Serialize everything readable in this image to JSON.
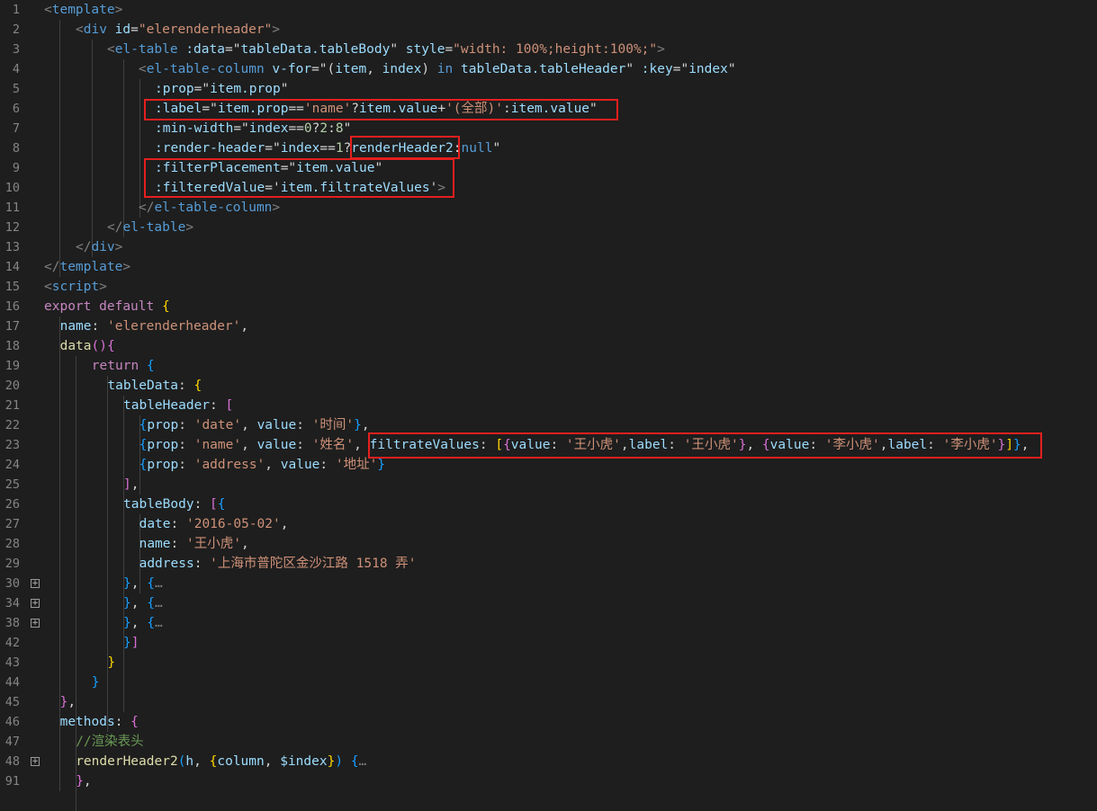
{
  "editor": {
    "language": "vue",
    "lines": [
      {
        "n": "1",
        "indent": 0,
        "fold": false,
        "tokens": [
          [
            "t-br",
            "<"
          ],
          [
            "t-tag",
            "template"
          ],
          [
            "t-br",
            ">"
          ]
        ]
      },
      {
        "n": "2",
        "indent": 1,
        "fold": false,
        "tokens": [
          [
            "t-br",
            "<"
          ],
          [
            "t-tag",
            "div"
          ],
          [
            "t-pl",
            " "
          ],
          [
            "t-attr",
            "id"
          ],
          [
            "t-pl",
            "="
          ],
          [
            "t-str",
            "\"elerenderheader\""
          ],
          [
            "t-br",
            ">"
          ]
        ]
      },
      {
        "n": "3",
        "indent": 2,
        "fold": false,
        "tokens": [
          [
            "t-br",
            "<"
          ],
          [
            "t-tag",
            "el-table"
          ],
          [
            "t-pl",
            " "
          ],
          [
            "t-attr",
            ":data"
          ],
          [
            "t-pl",
            "=\""
          ],
          [
            "t-attr",
            "tableData.tableBody"
          ],
          [
            "t-pl",
            "\" "
          ],
          [
            "t-attr",
            "style"
          ],
          [
            "t-pl",
            "="
          ],
          [
            "t-str",
            "\"width: 100%;height:100%;\""
          ],
          [
            "t-br",
            ">"
          ]
        ]
      },
      {
        "n": "4",
        "indent": 3,
        "fold": false,
        "tokens": [
          [
            "t-br",
            "<"
          ],
          [
            "t-tag",
            "el-table-column"
          ],
          [
            "t-pl",
            " "
          ],
          [
            "t-attr",
            "v-for"
          ],
          [
            "t-pl",
            "=\"("
          ],
          [
            "t-attr",
            "item"
          ],
          [
            "t-pl",
            ", "
          ],
          [
            "t-attr",
            "index"
          ],
          [
            "t-pl",
            ") "
          ],
          [
            "t-kw",
            "in"
          ],
          [
            "t-pl",
            " "
          ],
          [
            "t-attr",
            "tableData.tableHeader"
          ],
          [
            "t-pl",
            "\" "
          ],
          [
            "t-attr",
            ":key"
          ],
          [
            "t-pl",
            "=\""
          ],
          [
            "t-attr",
            "index"
          ],
          [
            "t-pl",
            "\""
          ]
        ]
      },
      {
        "n": "5",
        "indent": 3,
        "fold": false,
        "extra": 1,
        "tokens": [
          [
            "t-attr",
            ":prop"
          ],
          [
            "t-pl",
            "=\""
          ],
          [
            "t-attr",
            "item.prop"
          ],
          [
            "t-pl",
            "\""
          ]
        ]
      },
      {
        "n": "6",
        "indent": 3,
        "fold": false,
        "extra": 1,
        "tokens": [
          [
            "t-attr",
            ":label"
          ],
          [
            "t-pl",
            "=\""
          ],
          [
            "t-attr",
            "item.prop"
          ],
          [
            "t-pl",
            "=="
          ],
          [
            "t-str",
            "'name'"
          ],
          [
            "t-pl",
            "?"
          ],
          [
            "t-attr",
            "item.value"
          ],
          [
            "t-pl",
            "+"
          ],
          [
            "t-str",
            "'(全部)'"
          ],
          [
            "t-pl",
            ":"
          ],
          [
            "t-attr",
            "item.value"
          ],
          [
            "t-pl",
            "\""
          ]
        ]
      },
      {
        "n": "7",
        "indent": 3,
        "fold": false,
        "extra": 1,
        "tokens": [
          [
            "t-attr",
            ":min-width"
          ],
          [
            "t-pl",
            "=\""
          ],
          [
            "t-attr",
            "index"
          ],
          [
            "t-pl",
            "=="
          ],
          [
            "t-num",
            "0"
          ],
          [
            "t-pl",
            "?"
          ],
          [
            "t-num",
            "2"
          ],
          [
            "t-pl",
            ":"
          ],
          [
            "t-num",
            "8"
          ],
          [
            "t-pl",
            "\""
          ]
        ]
      },
      {
        "n": "8",
        "indent": 3,
        "fold": false,
        "extra": 1,
        "tokens": [
          [
            "t-attr",
            ":render-header"
          ],
          [
            "t-pl",
            "=\""
          ],
          [
            "t-attr",
            "index"
          ],
          [
            "t-pl",
            "=="
          ],
          [
            "t-num",
            "1"
          ],
          [
            "t-pl",
            "?"
          ],
          [
            "t-attr",
            "renderHeader2"
          ],
          [
            "t-pl",
            ":"
          ],
          [
            "t-kw",
            "null"
          ],
          [
            "t-pl",
            "\""
          ]
        ]
      },
      {
        "n": "9",
        "indent": 3,
        "fold": false,
        "extra": 1,
        "tokens": [
          [
            "t-attr",
            ":filterPlacement"
          ],
          [
            "t-pl",
            "=\""
          ],
          [
            "t-attr",
            "item.value"
          ],
          [
            "t-pl",
            "\""
          ]
        ]
      },
      {
        "n": "10",
        "indent": 3,
        "fold": false,
        "extra": 1,
        "tokens": [
          [
            "t-attr",
            ":filteredValue"
          ],
          [
            "t-pl",
            "='"
          ],
          [
            "t-attr",
            "item.filtrateValues"
          ],
          [
            "t-pl",
            "'"
          ],
          [
            "t-br",
            ">"
          ]
        ]
      },
      {
        "n": "11",
        "indent": 3,
        "fold": false,
        "tokens": [
          [
            "t-br",
            "</"
          ],
          [
            "t-tag",
            "el-table-column"
          ],
          [
            "t-br",
            ">"
          ]
        ]
      },
      {
        "n": "12",
        "indent": 2,
        "fold": false,
        "tokens": [
          [
            "t-br",
            "</"
          ],
          [
            "t-tag",
            "el-table"
          ],
          [
            "t-br",
            ">"
          ]
        ]
      },
      {
        "n": "13",
        "indent": 1,
        "fold": false,
        "tokens": [
          [
            "t-br",
            "</"
          ],
          [
            "t-tag",
            "div"
          ],
          [
            "t-br",
            ">"
          ]
        ]
      },
      {
        "n": "14",
        "indent": 0,
        "fold": false,
        "tokens": [
          [
            "t-br",
            "</"
          ],
          [
            "t-tag",
            "template"
          ],
          [
            "t-br",
            ">"
          ]
        ]
      },
      {
        "n": "15",
        "indent": 0,
        "fold": false,
        "tokens": [
          [
            "t-br",
            "<"
          ],
          [
            "t-tag",
            "script"
          ],
          [
            "t-br",
            ">"
          ]
        ]
      },
      {
        "n": "16",
        "indent": 0,
        "fold": false,
        "tokens": [
          [
            "t-ctrl",
            "export"
          ],
          [
            "t-pl",
            " "
          ],
          [
            "t-ctrl",
            "default"
          ],
          [
            "t-pl",
            " "
          ],
          [
            "t-br1",
            "{"
          ]
        ]
      },
      {
        "n": "17",
        "indent": 0,
        "fold": false,
        "sp": 1,
        "tokens": [
          [
            "t-attr",
            "name"
          ],
          [
            "t-pl",
            ": "
          ],
          [
            "t-str",
            "'elerenderheader'"
          ],
          [
            "t-pl",
            ","
          ]
        ]
      },
      {
        "n": "18",
        "indent": 0,
        "fold": false,
        "sp": 1,
        "tokens": [
          [
            "t-fn",
            "data"
          ],
          [
            "t-br2",
            "()"
          ],
          [
            "t-br2",
            "{"
          ]
        ]
      },
      {
        "n": "19",
        "indent": 0,
        "fold": false,
        "sp": 3,
        "tokens": [
          [
            "t-ctrl",
            "return"
          ],
          [
            "t-pl",
            " "
          ],
          [
            "t-br3",
            "{"
          ]
        ]
      },
      {
        "n": "20",
        "indent": 0,
        "fold": false,
        "sp": 4,
        "tokens": [
          [
            "t-attr",
            "tableData"
          ],
          [
            "t-pl",
            ": "
          ],
          [
            "t-br1",
            "{"
          ]
        ]
      },
      {
        "n": "21",
        "indent": 0,
        "fold": false,
        "sp": 5,
        "tokens": [
          [
            "t-attr",
            "tableHeader"
          ],
          [
            "t-pl",
            ": "
          ],
          [
            "t-br2",
            "["
          ]
        ]
      },
      {
        "n": "22",
        "indent": 0,
        "fold": false,
        "sp": 6,
        "tokens": [
          [
            "t-br3",
            "{"
          ],
          [
            "t-attr",
            "prop"
          ],
          [
            "t-pl",
            ": "
          ],
          [
            "t-str",
            "'date'"
          ],
          [
            "t-pl",
            ", "
          ],
          [
            "t-attr",
            "value"
          ],
          [
            "t-pl",
            ": "
          ],
          [
            "t-str",
            "'时间'"
          ],
          [
            "t-br3",
            "}"
          ],
          [
            "t-pl",
            ","
          ]
        ]
      },
      {
        "n": "23",
        "indent": 0,
        "fold": false,
        "sp": 6,
        "tokens": [
          [
            "t-br3",
            "{"
          ],
          [
            "t-attr",
            "prop"
          ],
          [
            "t-pl",
            ": "
          ],
          [
            "t-str",
            "'name'"
          ],
          [
            "t-pl",
            ", "
          ],
          [
            "t-attr",
            "value"
          ],
          [
            "t-pl",
            ": "
          ],
          [
            "t-str",
            "'姓名'"
          ],
          [
            "t-pl",
            ", "
          ],
          [
            "t-attr",
            "filtrateValues"
          ],
          [
            "t-pl",
            ": "
          ],
          [
            "t-br1",
            "["
          ],
          [
            "t-br2",
            "{"
          ],
          [
            "t-attr",
            "value"
          ],
          [
            "t-pl",
            ": "
          ],
          [
            "t-str",
            "'王小虎'"
          ],
          [
            "t-pl",
            ","
          ],
          [
            "t-attr",
            "label"
          ],
          [
            "t-pl",
            ": "
          ],
          [
            "t-str",
            "'王小虎'"
          ],
          [
            "t-br2",
            "}"
          ],
          [
            "t-pl",
            ", "
          ],
          [
            "t-br2",
            "{"
          ],
          [
            "t-attr",
            "value"
          ],
          [
            "t-pl",
            ": "
          ],
          [
            "t-str",
            "'李小虎'"
          ],
          [
            "t-pl",
            ","
          ],
          [
            "t-attr",
            "label"
          ],
          [
            "t-pl",
            ": "
          ],
          [
            "t-str",
            "'李小虎'"
          ],
          [
            "t-br2",
            "}"
          ],
          [
            "t-br1",
            "]"
          ],
          [
            "t-br3",
            "}"
          ],
          [
            "t-pl",
            ","
          ]
        ]
      },
      {
        "n": "24",
        "indent": 0,
        "fold": false,
        "sp": 6,
        "tokens": [
          [
            "t-br3",
            "{"
          ],
          [
            "t-attr",
            "prop"
          ],
          [
            "t-pl",
            ": "
          ],
          [
            "t-str",
            "'address'"
          ],
          [
            "t-pl",
            ", "
          ],
          [
            "t-attr",
            "value"
          ],
          [
            "t-pl",
            ": "
          ],
          [
            "t-str",
            "'地址'"
          ],
          [
            "t-br3",
            "}"
          ]
        ]
      },
      {
        "n": "25",
        "indent": 0,
        "fold": false,
        "sp": 5,
        "tokens": [
          [
            "t-br2",
            "]"
          ],
          [
            "t-pl",
            ","
          ]
        ]
      },
      {
        "n": "26",
        "indent": 0,
        "fold": false,
        "sp": 5,
        "tokens": [
          [
            "t-attr",
            "tableBody"
          ],
          [
            "t-pl",
            ": "
          ],
          [
            "t-br2",
            "["
          ],
          [
            "t-br3",
            "{"
          ]
        ]
      },
      {
        "n": "27",
        "indent": 0,
        "fold": false,
        "sp": 6,
        "tokens": [
          [
            "t-attr",
            "date"
          ],
          [
            "t-pl",
            ": "
          ],
          [
            "t-str",
            "'2016-05-02'"
          ],
          [
            "t-pl",
            ","
          ]
        ]
      },
      {
        "n": "28",
        "indent": 0,
        "fold": false,
        "sp": 6,
        "tokens": [
          [
            "t-attr",
            "name"
          ],
          [
            "t-pl",
            ": "
          ],
          [
            "t-str",
            "'王小虎'"
          ],
          [
            "t-pl",
            ","
          ]
        ]
      },
      {
        "n": "29",
        "indent": 0,
        "fold": false,
        "sp": 6,
        "tokens": [
          [
            "t-attr",
            "address"
          ],
          [
            "t-pl",
            ": "
          ],
          [
            "t-str",
            "'上海市普陀区金沙江路 1518 弄'"
          ]
        ]
      },
      {
        "n": "30",
        "indent": 0,
        "fold": true,
        "sp": 5,
        "tokens": [
          [
            "t-br3",
            "}"
          ],
          [
            "t-pl",
            ", "
          ],
          [
            "t-br3",
            "{"
          ],
          [
            "t-dim",
            "…"
          ]
        ]
      },
      {
        "n": "34",
        "indent": 0,
        "fold": true,
        "sp": 5,
        "tokens": [
          [
            "t-br3",
            "}"
          ],
          [
            "t-pl",
            ", "
          ],
          [
            "t-br3",
            "{"
          ],
          [
            "t-dim",
            "…"
          ]
        ]
      },
      {
        "n": "38",
        "indent": 0,
        "fold": true,
        "sp": 5,
        "tokens": [
          [
            "t-br3",
            "}"
          ],
          [
            "t-pl",
            ", "
          ],
          [
            "t-br3",
            "{"
          ],
          [
            "t-dim",
            "…"
          ]
        ]
      },
      {
        "n": "42",
        "indent": 0,
        "fold": false,
        "sp": 5,
        "tokens": [
          [
            "t-br3",
            "}"
          ],
          [
            "t-br2",
            "]"
          ]
        ]
      },
      {
        "n": "43",
        "indent": 0,
        "fold": false,
        "sp": 4,
        "tokens": [
          [
            "t-br1",
            "}"
          ]
        ]
      },
      {
        "n": "44",
        "indent": 0,
        "fold": false,
        "sp": 3,
        "tokens": [
          [
            "t-br3",
            "}"
          ]
        ]
      },
      {
        "n": "45",
        "indent": 0,
        "fold": false,
        "sp": 1,
        "tokens": [
          [
            "t-br2",
            "}"
          ],
          [
            "t-pl",
            ","
          ]
        ]
      },
      {
        "n": "46",
        "indent": 0,
        "fold": false,
        "sp": 1,
        "tokens": [
          [
            "t-attr",
            "methods"
          ],
          [
            "t-pl",
            ": "
          ],
          [
            "t-br2",
            "{"
          ]
        ]
      },
      {
        "n": "47",
        "indent": 0,
        "fold": false,
        "sp": 2,
        "tokens": [
          [
            "t-com",
            "//渲染表头"
          ]
        ]
      },
      {
        "n": "48",
        "indent": 0,
        "fold": true,
        "sp": 2,
        "tokens": [
          [
            "t-fn",
            "renderHeader2"
          ],
          [
            "t-br3",
            "("
          ],
          [
            "t-attr",
            "h"
          ],
          [
            "t-pl",
            ", "
          ],
          [
            "t-br1",
            "{"
          ],
          [
            "t-attr",
            "column"
          ],
          [
            "t-pl",
            ", "
          ],
          [
            "t-attr",
            "$index"
          ],
          [
            "t-br1",
            "}"
          ],
          [
            "t-br3",
            ")"
          ],
          [
            "t-pl",
            " "
          ],
          [
            "t-br3",
            "{"
          ],
          [
            "t-dim",
            "…"
          ]
        ]
      },
      {
        "n": "91",
        "indent": 0,
        "fold": false,
        "sp": 2,
        "tokens": [
          [
            "t-br2",
            "}"
          ],
          [
            "t-pl",
            ","
          ]
        ]
      }
    ],
    "fold_glyph": "+"
  }
}
